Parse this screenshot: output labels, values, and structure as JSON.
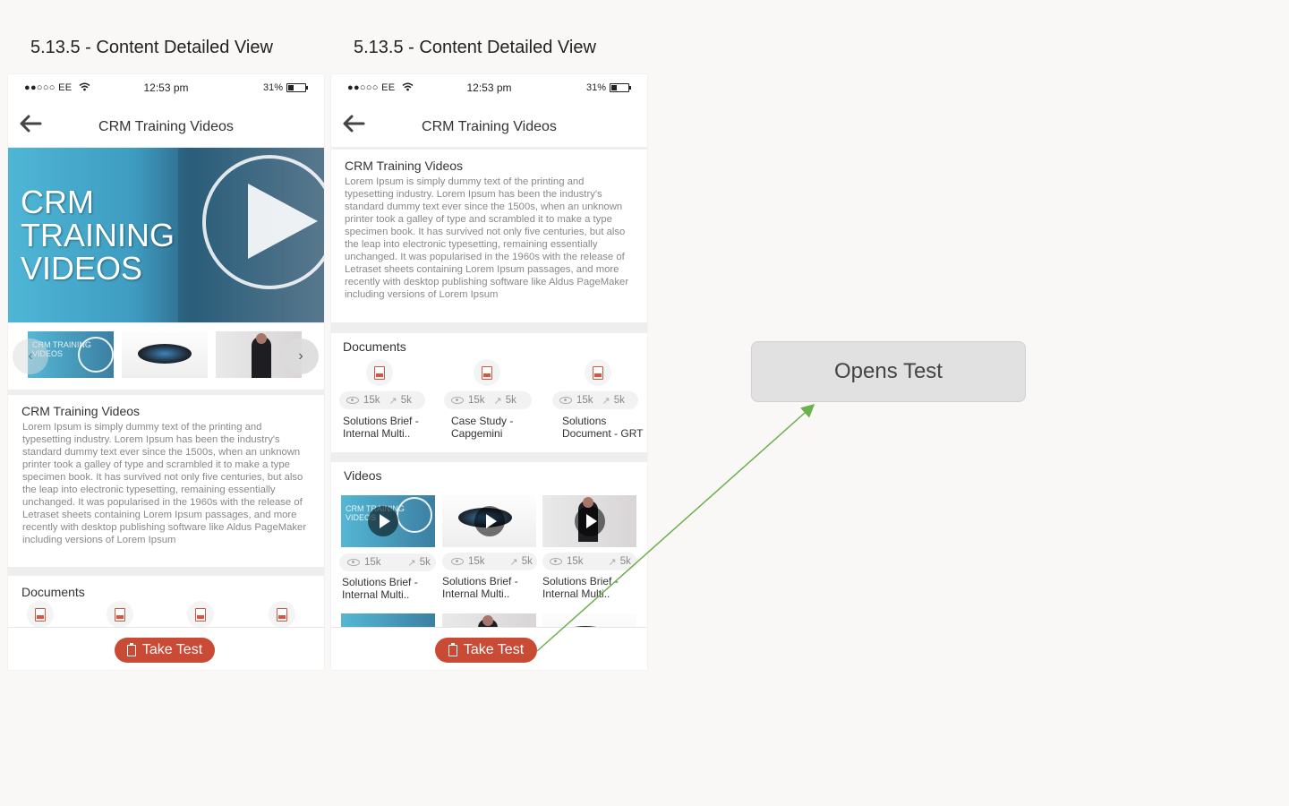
{
  "screen_titles": [
    "5.13.5 - Content Detailed View",
    "5.13.5 - Content Detailed View"
  ],
  "status_bar": {
    "carrier": "●●○○○ EE",
    "time": "12:53 pm",
    "battery": "31%"
  },
  "nav": {
    "title": "CRM Training Videos"
  },
  "hero": {
    "line1": "CRM",
    "line2": "TRAINING",
    "line3": "VIDEOS"
  },
  "thumb_crm_text": "CRM TRAINING VIDEOS",
  "thumb_crm_small": "CRM TRAINING VIDEOS",
  "description": {
    "title": "CRM Training Videos",
    "body": "Lorem Ipsum is simply dummy text of the printing and typesetting industry. Lorem Ipsum has been the industry's standard dummy text ever since the 1500s, when an unknown printer took a galley of type and scrambled it to make a type specimen book. It has survived not only five centuries, but also the leap into electronic typesetting, remaining essentially unchanged. It was popularised in the 1960s with the release of Letraset sheets containing Lorem Ipsum passages, and more recently with desktop publishing software like Aldus PageMaker including versions of Lorem Ipsum"
  },
  "documents": {
    "title": "Documents",
    "items": [
      {
        "views": "15k",
        "shares": "5k",
        "label_line1": "Solutions Brief -",
        "label_line2": "Internal Multi.."
      },
      {
        "views": "15k",
        "shares": "5k",
        "label_line1": "Case Study -",
        "label_line2": "Capgemini"
      },
      {
        "views": "15k",
        "shares": "5k",
        "label_line1": "Solutions",
        "label_line2": "Document - GRT"
      }
    ]
  },
  "videos": {
    "title": "Videos",
    "items": [
      {
        "views": "15k",
        "shares": "5k",
        "label_line1": "Solutions Brief -",
        "label_line2": "Internal Multi.."
      },
      {
        "views": "15k",
        "shares": "5k",
        "label_line1": "Solutions Brief -",
        "label_line2": "Internal Multi.."
      },
      {
        "views": "15k",
        "shares": "5k",
        "label_line1": "Solutions Brief -",
        "label_line2": "Internal Multi.."
      }
    ]
  },
  "footer": {
    "take_test": "Take Test"
  },
  "annotation": {
    "label": "Opens Test"
  },
  "colors": {
    "accent": "#c94a35",
    "arrow": "#6ab04c",
    "background": "#f9f8f7"
  },
  "icons": [
    "back-arrow-icon",
    "wifi-icon",
    "battery-icon",
    "pdf-icon",
    "eye-icon",
    "share-icon",
    "clipboard-icon",
    "play-icon",
    "chevron-left-icon",
    "chevron-right-icon"
  ]
}
